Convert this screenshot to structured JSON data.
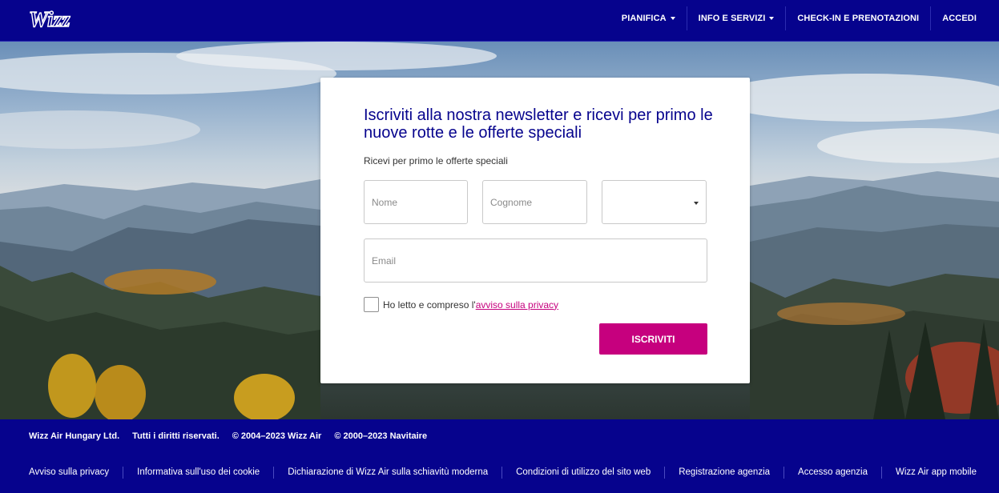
{
  "brand": {
    "logo_text": "Wizz"
  },
  "nav": {
    "items": [
      {
        "label": "PIANIFICA",
        "has_caret": true
      },
      {
        "label": "INFO E SERVIZI",
        "has_caret": true
      },
      {
        "label": "CHECK-IN E PRENOTAZIONI",
        "has_caret": false
      },
      {
        "label": "ACCEDI",
        "has_caret": false
      }
    ]
  },
  "newsletter": {
    "title": "Iscriviti alla nostra newsletter e ricevi per primo le nuove rotte e le offerte speciali",
    "subtitle": "Ricevi per primo le offerte speciali",
    "first_name_placeholder": "Nome",
    "last_name_placeholder": "Cognome",
    "select_value": "",
    "email_placeholder": "Email",
    "privacy_text": "Ho letto e compreso l'",
    "privacy_link": "avviso sulla privacy",
    "privacy_checked": false,
    "submit_label": "ISCRIVITI"
  },
  "footer": {
    "legal": [
      "Wizz Air Hungary Ltd.",
      "Tutti i diritti riservati.",
      "© 2004–2023 Wizz Air",
      "© 2000–2023 Navitaire"
    ],
    "links": [
      "Avviso sulla privacy",
      "Informativa sull'uso dei cookie",
      "Dichiarazione di Wizz Air sulla schiavitù moderna",
      "Condizioni di utilizzo del sito web",
      "Registrazione agenzia",
      "Accesso agenzia",
      "Wizz Air app mobile"
    ]
  },
  "colors": {
    "brand_navy": "#06038d",
    "accent_magenta": "#c6007e",
    "title_color": "#06038d"
  }
}
